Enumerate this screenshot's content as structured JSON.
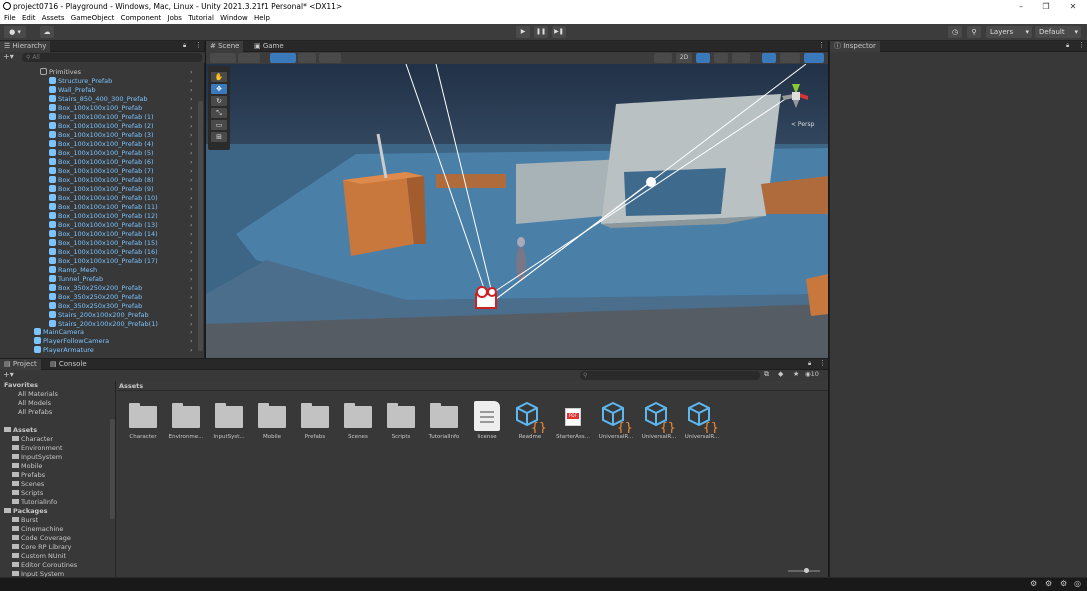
{
  "window": {
    "title": "project0716 - Playground - Windows, Mac, Linux - Unity 2021.3.21f1 Personal* <DX11>"
  },
  "menu": [
    "File",
    "Edit",
    "Assets",
    "GameObject",
    "Component",
    "Jobs",
    "Tutorial",
    "Window",
    "Help"
  ],
  "toolbar": {
    "layers_label": "Layers",
    "layout_label": "Default"
  },
  "hierarchy": {
    "tab_label": "Hierarchy",
    "search_placeholder": "All",
    "items": [
      {
        "label": "Primitives",
        "color": "#c8c8c8"
      },
      {
        "label": "Structure_Prefab",
        "color": "#7cc4ff"
      },
      {
        "label": "Wall_Prefab",
        "color": "#7cc4ff"
      },
      {
        "label": "Stairs_850_400_300_Prefab",
        "color": "#7cc4ff"
      },
      {
        "label": "Box_100x100x100_Prefab",
        "color": "#7cc4ff"
      },
      {
        "label": "Box_100x100x100_Prefab (1)",
        "color": "#7cc4ff"
      },
      {
        "label": "Box_100x100x100_Prefab (2)",
        "color": "#7cc4ff"
      },
      {
        "label": "Box_100x100x100_Prefab (3)",
        "color": "#7cc4ff"
      },
      {
        "label": "Box_100x100x100_Prefab (4)",
        "color": "#7cc4ff"
      },
      {
        "label": "Box_100x100x100_Prefab (5)",
        "color": "#7cc4ff"
      },
      {
        "label": "Box_100x100x100_Prefab (6)",
        "color": "#7cc4ff"
      },
      {
        "label": "Box_100x100x100_Prefab (7)",
        "color": "#7cc4ff"
      },
      {
        "label": "Box_100x100x100_Prefab (8)",
        "color": "#7cc4ff"
      },
      {
        "label": "Box_100x100x100_Prefab (9)",
        "color": "#7cc4ff"
      },
      {
        "label": "Box_100x100x100_Prefab (10)",
        "color": "#7cc4ff"
      },
      {
        "label": "Box_100x100x100_Prefab (11)",
        "color": "#7cc4ff"
      },
      {
        "label": "Box_100x100x100_Prefab (12)",
        "color": "#7cc4ff"
      },
      {
        "label": "Box_100x100x100_Prefab (13)",
        "color": "#7cc4ff"
      },
      {
        "label": "Box_100x100x100_Prefab (14)",
        "color": "#7cc4ff"
      },
      {
        "label": "Box_100x100x100_Prefab (15)",
        "color": "#7cc4ff"
      },
      {
        "label": "Box_100x100x100_Prefab (16)",
        "color": "#7cc4ff"
      },
      {
        "label": "Box_100x100x100_Prefab (17)",
        "color": "#7cc4ff"
      },
      {
        "label": "Ramp_Mesh",
        "color": "#7cc4ff"
      },
      {
        "label": "Tunnel_Prefab",
        "color": "#7cc4ff"
      },
      {
        "label": "Box_350x250x200_Prefab",
        "color": "#7cc4ff"
      },
      {
        "label": "Box_350x250x200_Prefab",
        "color": "#7cc4ff"
      },
      {
        "label": "Box_350x250x300_Prefab",
        "color": "#7cc4ff"
      },
      {
        "label": "Stairs_200x100x200_Prefab",
        "color": "#7cc4ff"
      },
      {
        "label": "Stairs_200x100x200_Prefab(1)",
        "color": "#7cc4ff"
      }
    ],
    "root_items": [
      {
        "label": "MainCamera"
      },
      {
        "label": "PlayerFollowCamera"
      },
      {
        "label": "PlayerArmature"
      }
    ]
  },
  "scene": {
    "tab_scene": "Scene",
    "tab_game": "Game",
    "toolbar_2d": "2D",
    "gizmo_label": "< Persp"
  },
  "inspector": {
    "tab_label": "Inspector"
  },
  "project": {
    "tab_project": "Project",
    "tab_console": "Console",
    "favorites_label": "Favorites",
    "favorites": [
      "All Materials",
      "All Models",
      "All Prefabs"
    ],
    "assets_label": "Assets",
    "assets_tree": [
      "Character",
      "Environment",
      "InputSystem",
      "Mobile",
      "Prefabs",
      "Scenes",
      "Scripts",
      "TutorialInfo"
    ],
    "packages_label": "Packages",
    "packages_tree": [
      "Burst",
      "Cinemachine",
      "Code Coverage",
      "Core RP Library",
      "Custom NUnit",
      "Editor Coroutines",
      "Input System"
    ],
    "breadcrumb": "Assets",
    "hidden_count": "10",
    "items": [
      {
        "label": "Character",
        "kind": "folder"
      },
      {
        "label": "Environme...",
        "kind": "folder"
      },
      {
        "label": "InputSyst...",
        "kind": "folder"
      },
      {
        "label": "Mobile",
        "kind": "folder"
      },
      {
        "label": "Prefabs",
        "kind": "folder"
      },
      {
        "label": "Scenes",
        "kind": "folder"
      },
      {
        "label": "Scripts",
        "kind": "folder"
      },
      {
        "label": "TutorialInfo",
        "kind": "folder"
      },
      {
        "label": "license",
        "kind": "text"
      },
      {
        "label": "Readme",
        "kind": "script"
      },
      {
        "label": "StarterAss...",
        "kind": "pdf"
      },
      {
        "label": "UniversalR...",
        "kind": "script"
      },
      {
        "label": "UniversalR...",
        "kind": "script"
      },
      {
        "label": "UniversalR...",
        "kind": "script"
      }
    ]
  },
  "colors": {
    "accent": "#3a79bb",
    "prefab": "#7cc4ff",
    "bg": "#383838"
  }
}
